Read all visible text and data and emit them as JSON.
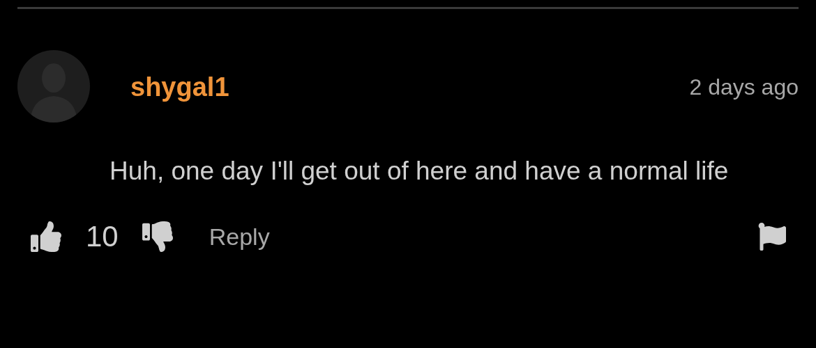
{
  "comment": {
    "username": "shygal1",
    "time": "2 days ago",
    "text": "Huh, one day I'll get out of here and have a normal life",
    "likes": "10",
    "reply": "Reply"
  }
}
